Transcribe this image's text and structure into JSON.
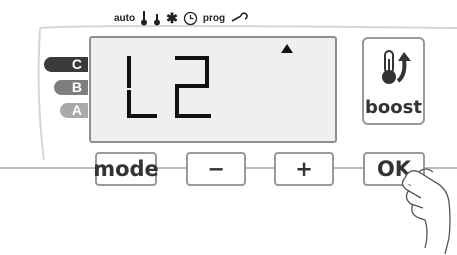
{
  "mode_icons": {
    "auto_label": "auto",
    "thermometer_1": "thermometer-icon",
    "thermometer_2": "thermometer-icon",
    "snowflake": "snowflake-icon",
    "clock": "clock-icon",
    "prog_label": "prog",
    "wrench": "wrench-icon"
  },
  "lcd": {
    "value": "L2",
    "indicator": "triangle-up-icon"
  },
  "levels": [
    {
      "label": "C"
    },
    {
      "label": "B"
    },
    {
      "label": "A"
    }
  ],
  "boost": {
    "label": "boost",
    "icon": "thermometer-up-icon"
  },
  "buttons": {
    "mode_label": "mode",
    "minus_label": "−",
    "plus_label": "+",
    "ok_label": "OK"
  },
  "colors": {
    "level_c": "#3a3a3a",
    "level_b": "#7e7e7e",
    "level_a": "#a9a9a9",
    "lcd_bg": "#efefef"
  }
}
